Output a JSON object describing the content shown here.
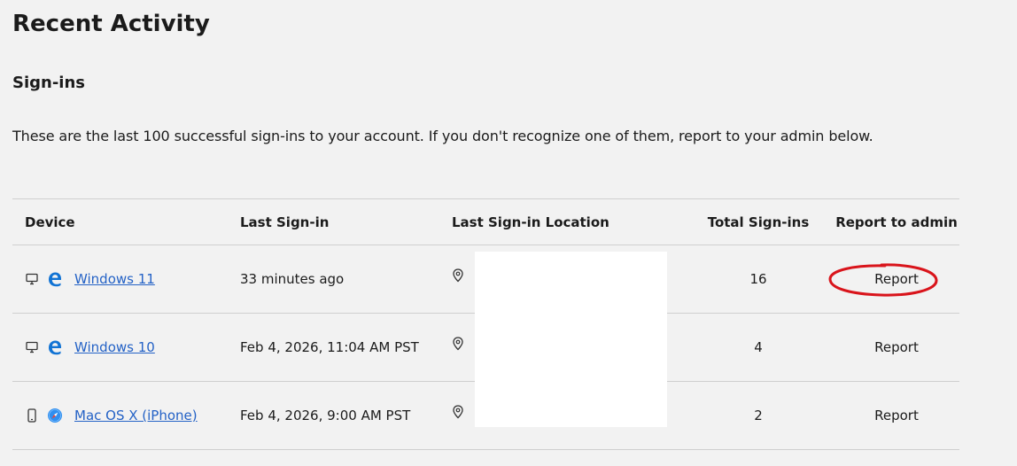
{
  "page": {
    "title": "Recent Activity",
    "section_title": "Sign-ins",
    "description": "These are the last 100 successful sign-ins to your account. If you don't recognize one of them, report to your admin below."
  },
  "table": {
    "headers": {
      "device": "Device",
      "last_signin": "Last Sign-in",
      "location": "Last Sign-in Location",
      "total": "Total Sign-ins",
      "report": "Report to admin"
    },
    "rows": [
      {
        "device_type_icon": "desktop-icon",
        "browser_icon": "edge-icon",
        "device": "Windows 11",
        "last_signin": "33 minutes ago",
        "location_icon": "location-pin-icon",
        "location": "",
        "total": "16",
        "report_label": "Report",
        "report_highlighted": true
      },
      {
        "device_type_icon": "desktop-icon",
        "browser_icon": "edge-icon",
        "device": "Windows 10",
        "last_signin": "Feb 4, 2026, 11:04 AM PST",
        "location_icon": "location-pin-icon",
        "location": "",
        "total": "4",
        "report_label": "Report",
        "report_highlighted": false
      },
      {
        "device_type_icon": "mobile-phone-icon",
        "browser_icon": "safari-icon",
        "device": "Mac OS X (iPhone)",
        "last_signin": "Feb 4, 2026, 9:00 AM PST",
        "location_icon": "location-pin-icon",
        "location": "",
        "total": "2",
        "report_label": "Report",
        "report_highlighted": false
      }
    ]
  },
  "colors": {
    "background": "#f2f2f2",
    "link": "#2462c6",
    "edge_blue": "#1173d4",
    "safari_blue": "#2f8ff0",
    "annotation_red": "#d9141b",
    "redaction": "#ffffff"
  }
}
